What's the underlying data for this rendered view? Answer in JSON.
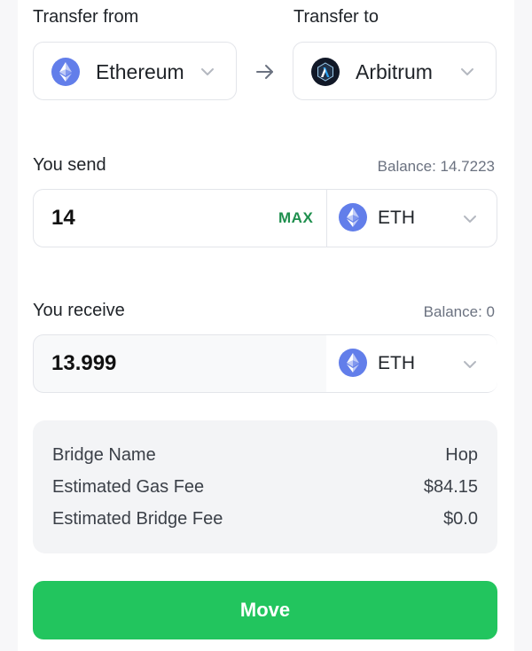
{
  "transfer_from": {
    "label": "Transfer from",
    "chain": "Ethereum",
    "icon": "ethereum-icon"
  },
  "transfer_to": {
    "label": "Transfer to",
    "chain": "Arbitrum",
    "icon": "arbitrum-icon"
  },
  "send": {
    "label": "You send",
    "balance": "Balance: 14.7223",
    "amount": "14",
    "max_label": "MAX",
    "token": "ETH"
  },
  "receive": {
    "label": "You receive",
    "balance": "Balance: 0",
    "amount": "13.999",
    "token": "ETH"
  },
  "details": {
    "rows": [
      {
        "key": "Bridge Name",
        "value": "Hop"
      },
      {
        "key": "Estimated Gas Fee",
        "value": "$84.15"
      },
      {
        "key": "Estimated Bridge Fee",
        "value": "$0.0"
      }
    ]
  },
  "move_button": "Move",
  "colors": {
    "accent_green": "#22c55e",
    "max_green": "#1f8f4e",
    "eth_purple": "#627eea",
    "arbitrum_dark": "#213147",
    "arbitrum_blue": "#28a0f0"
  }
}
